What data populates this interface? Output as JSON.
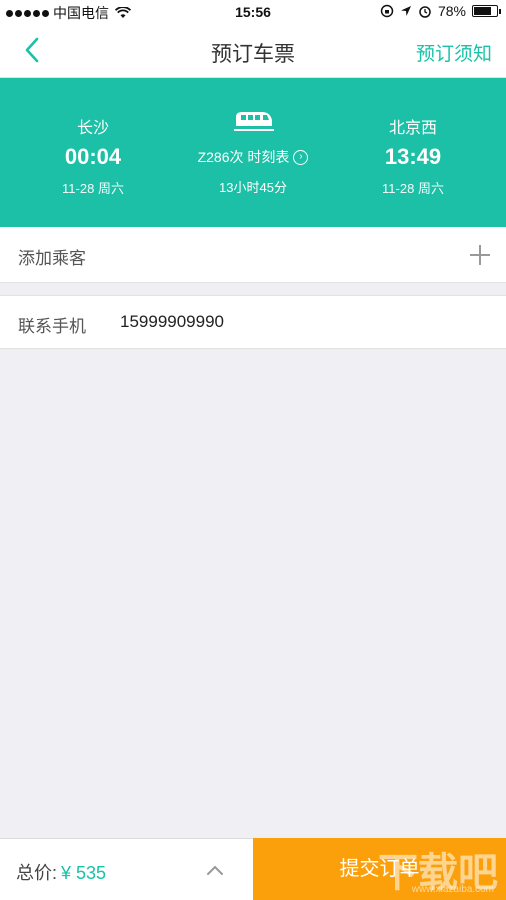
{
  "status_bar": {
    "carrier": "中国电信",
    "time": "15:56",
    "battery_percent": "78%",
    "battery_level": 0.78
  },
  "nav": {
    "title": "预订车票",
    "right_label": "预订须知"
  },
  "trip": {
    "departure": {
      "station": "长沙",
      "time": "00:04",
      "date": "11-28 周六"
    },
    "arrival": {
      "station": "北京西",
      "time": "13:49",
      "date": "11-28 周六"
    },
    "train_label": "Z286次 时刻表",
    "duration": "13小时45分"
  },
  "passenger": {
    "label": "添加乘客"
  },
  "contact": {
    "label": "联系手机",
    "value": "15999909990"
  },
  "footer": {
    "total_label": "总价:",
    "price": "¥ 535",
    "submit_label": "提交订单"
  },
  "watermark": {
    "text": "下载吧",
    "url": "www.xiazaiba.com"
  },
  "colors": {
    "accent": "#1bc0a6",
    "submit": "#fb9f0b"
  }
}
